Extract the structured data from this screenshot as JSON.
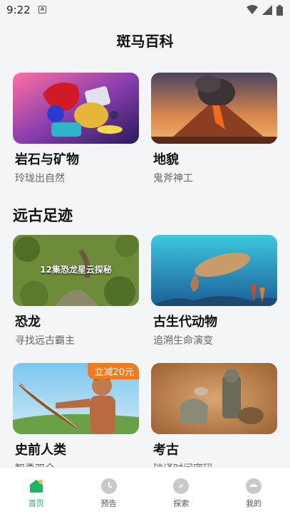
{
  "status": {
    "time": "9:22",
    "notif_icon": "A"
  },
  "header": {
    "title": "斑马百科"
  },
  "section1": {
    "items": [
      {
        "name": "岩石与矿物",
        "sub": "玲珑出自然",
        "icon": "gems-image"
      },
      {
        "name": "地貌",
        "sub": "鬼斧神工",
        "icon": "volcano-image"
      }
    ]
  },
  "section2": {
    "title": "远古足迹",
    "items": [
      {
        "name": "恐龙",
        "sub": "寻找远古霸主",
        "caption": "12集恐龙星云探秘",
        "icon": "dinosaur-image"
      },
      {
        "name": "古生代动物",
        "sub": "追溯生命演变",
        "icon": "trilobite-image"
      },
      {
        "name": "史前人类",
        "sub": "智勇双全",
        "badge": "立减20元",
        "icon": "caveman-image"
      },
      {
        "name": "考古",
        "sub": "破译时间密码",
        "icon": "artifacts-image"
      }
    ]
  },
  "tabbar": {
    "tabs": [
      {
        "label": "首页",
        "active": true
      },
      {
        "label": "预告"
      },
      {
        "label": "探索"
      },
      {
        "label": "我的"
      }
    ]
  },
  "colors": {
    "accent": "#1fb567",
    "badge": "#f07b1e",
    "background": "#f4f5f7"
  }
}
